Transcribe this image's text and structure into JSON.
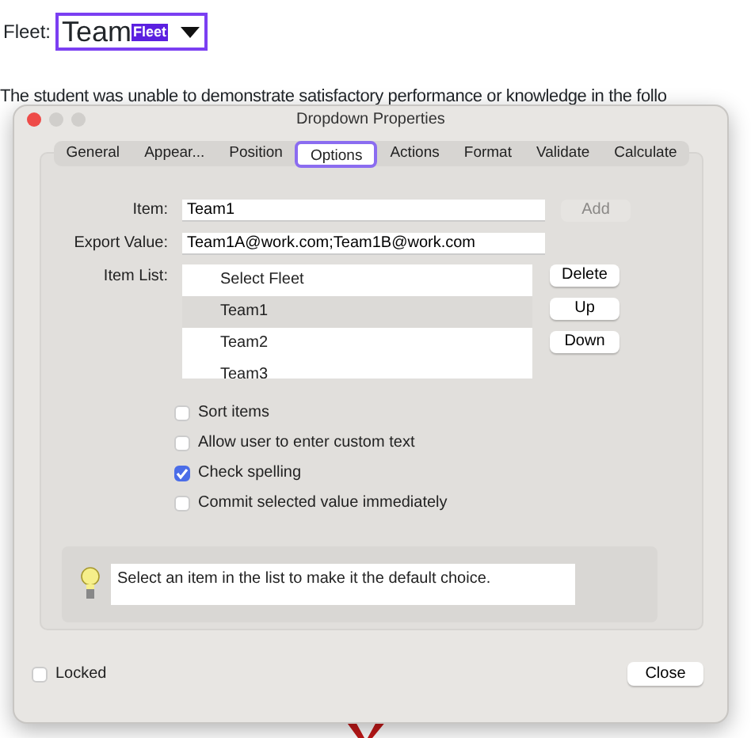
{
  "document": {
    "field_label": "Fleet:",
    "field_value": "Team",
    "field_tag": "Fleet",
    "sentence": "The student was unable to demonstrate satisfactory performance or knowledge in the follo"
  },
  "window": {
    "title": "Dropdown Properties"
  },
  "tabs": [
    {
      "label": "General",
      "selected": false
    },
    {
      "label": "Appear...",
      "selected": false
    },
    {
      "label": "Position",
      "selected": false
    },
    {
      "label": "Options",
      "selected": true
    },
    {
      "label": "Actions",
      "selected": false
    },
    {
      "label": "Format",
      "selected": false
    },
    {
      "label": "Validate",
      "selected": false
    },
    {
      "label": "Calculate",
      "selected": false
    }
  ],
  "item": {
    "label": "Item:",
    "value": "Team1",
    "button": "Add",
    "button_disabled": true
  },
  "export": {
    "label": "Export Value:",
    "value": "Team1A@work.com;Team1B@work.com"
  },
  "item_list": {
    "label": "Item List:",
    "items": [
      {
        "text": "Select Fleet",
        "selected": false
      },
      {
        "text": "Team1",
        "selected": true
      },
      {
        "text": "Team2",
        "selected": false
      },
      {
        "text": "Team3",
        "selected": false
      }
    ],
    "buttons": [
      "Delete",
      "Up",
      "Down"
    ]
  },
  "options": [
    {
      "label": "Sort items",
      "checked": false
    },
    {
      "label": "Allow user to enter custom text",
      "checked": false
    },
    {
      "label": "Check spelling",
      "checked": true
    },
    {
      "label": "Commit selected value immediately",
      "checked": false
    }
  ],
  "hint": "Select an item in the list to make it the default choice.",
  "locked": {
    "label": "Locked",
    "checked": false
  },
  "close_button": "Close"
}
